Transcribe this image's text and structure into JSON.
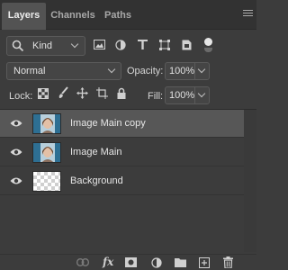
{
  "tabs": [
    {
      "label": "Layers",
      "active": true
    },
    {
      "label": "Channels",
      "active": false
    },
    {
      "label": "Paths",
      "active": false
    }
  ],
  "filter": {
    "kind_label": "Kind",
    "icons": [
      "image-filter-icon",
      "adjustment-filter-icon",
      "type-filter-icon",
      "shape-filter-icon",
      "smart-object-filter-icon",
      "filter-toggle"
    ]
  },
  "blend": {
    "mode": "Normal",
    "opacity_label": "Opacity:",
    "opacity_value": "100%"
  },
  "lock": {
    "label": "Lock:",
    "icons": [
      "lock-transparent-pixels-icon",
      "lock-image-pixels-icon",
      "lock-position-icon",
      "lock-artboard-icon",
      "lock-all-icon"
    ],
    "fill_label": "Fill:",
    "fill_value": "100%"
  },
  "layers": [
    {
      "name": "Image Main copy",
      "selected": true,
      "visible": true,
      "thumbnail": "portrait"
    },
    {
      "name": "Image Main",
      "selected": false,
      "visible": true,
      "thumbnail": "portrait"
    },
    {
      "name": "Background",
      "selected": false,
      "visible": true,
      "thumbnail": "transparent"
    }
  ],
  "bottom_bar": {
    "icons": [
      "link-layers-icon",
      "fx-icon",
      "add-mask-icon",
      "adjustment-layer-icon",
      "new-group-icon",
      "new-layer-icon",
      "delete-layer-icon"
    ],
    "fx_label": "fx"
  },
  "colors": {
    "panel_bg": "#3c3c3c",
    "tab_bg": "#323232",
    "active_tab": "#535353",
    "selected_layer": "#575757",
    "text": "#e6e6e6"
  }
}
